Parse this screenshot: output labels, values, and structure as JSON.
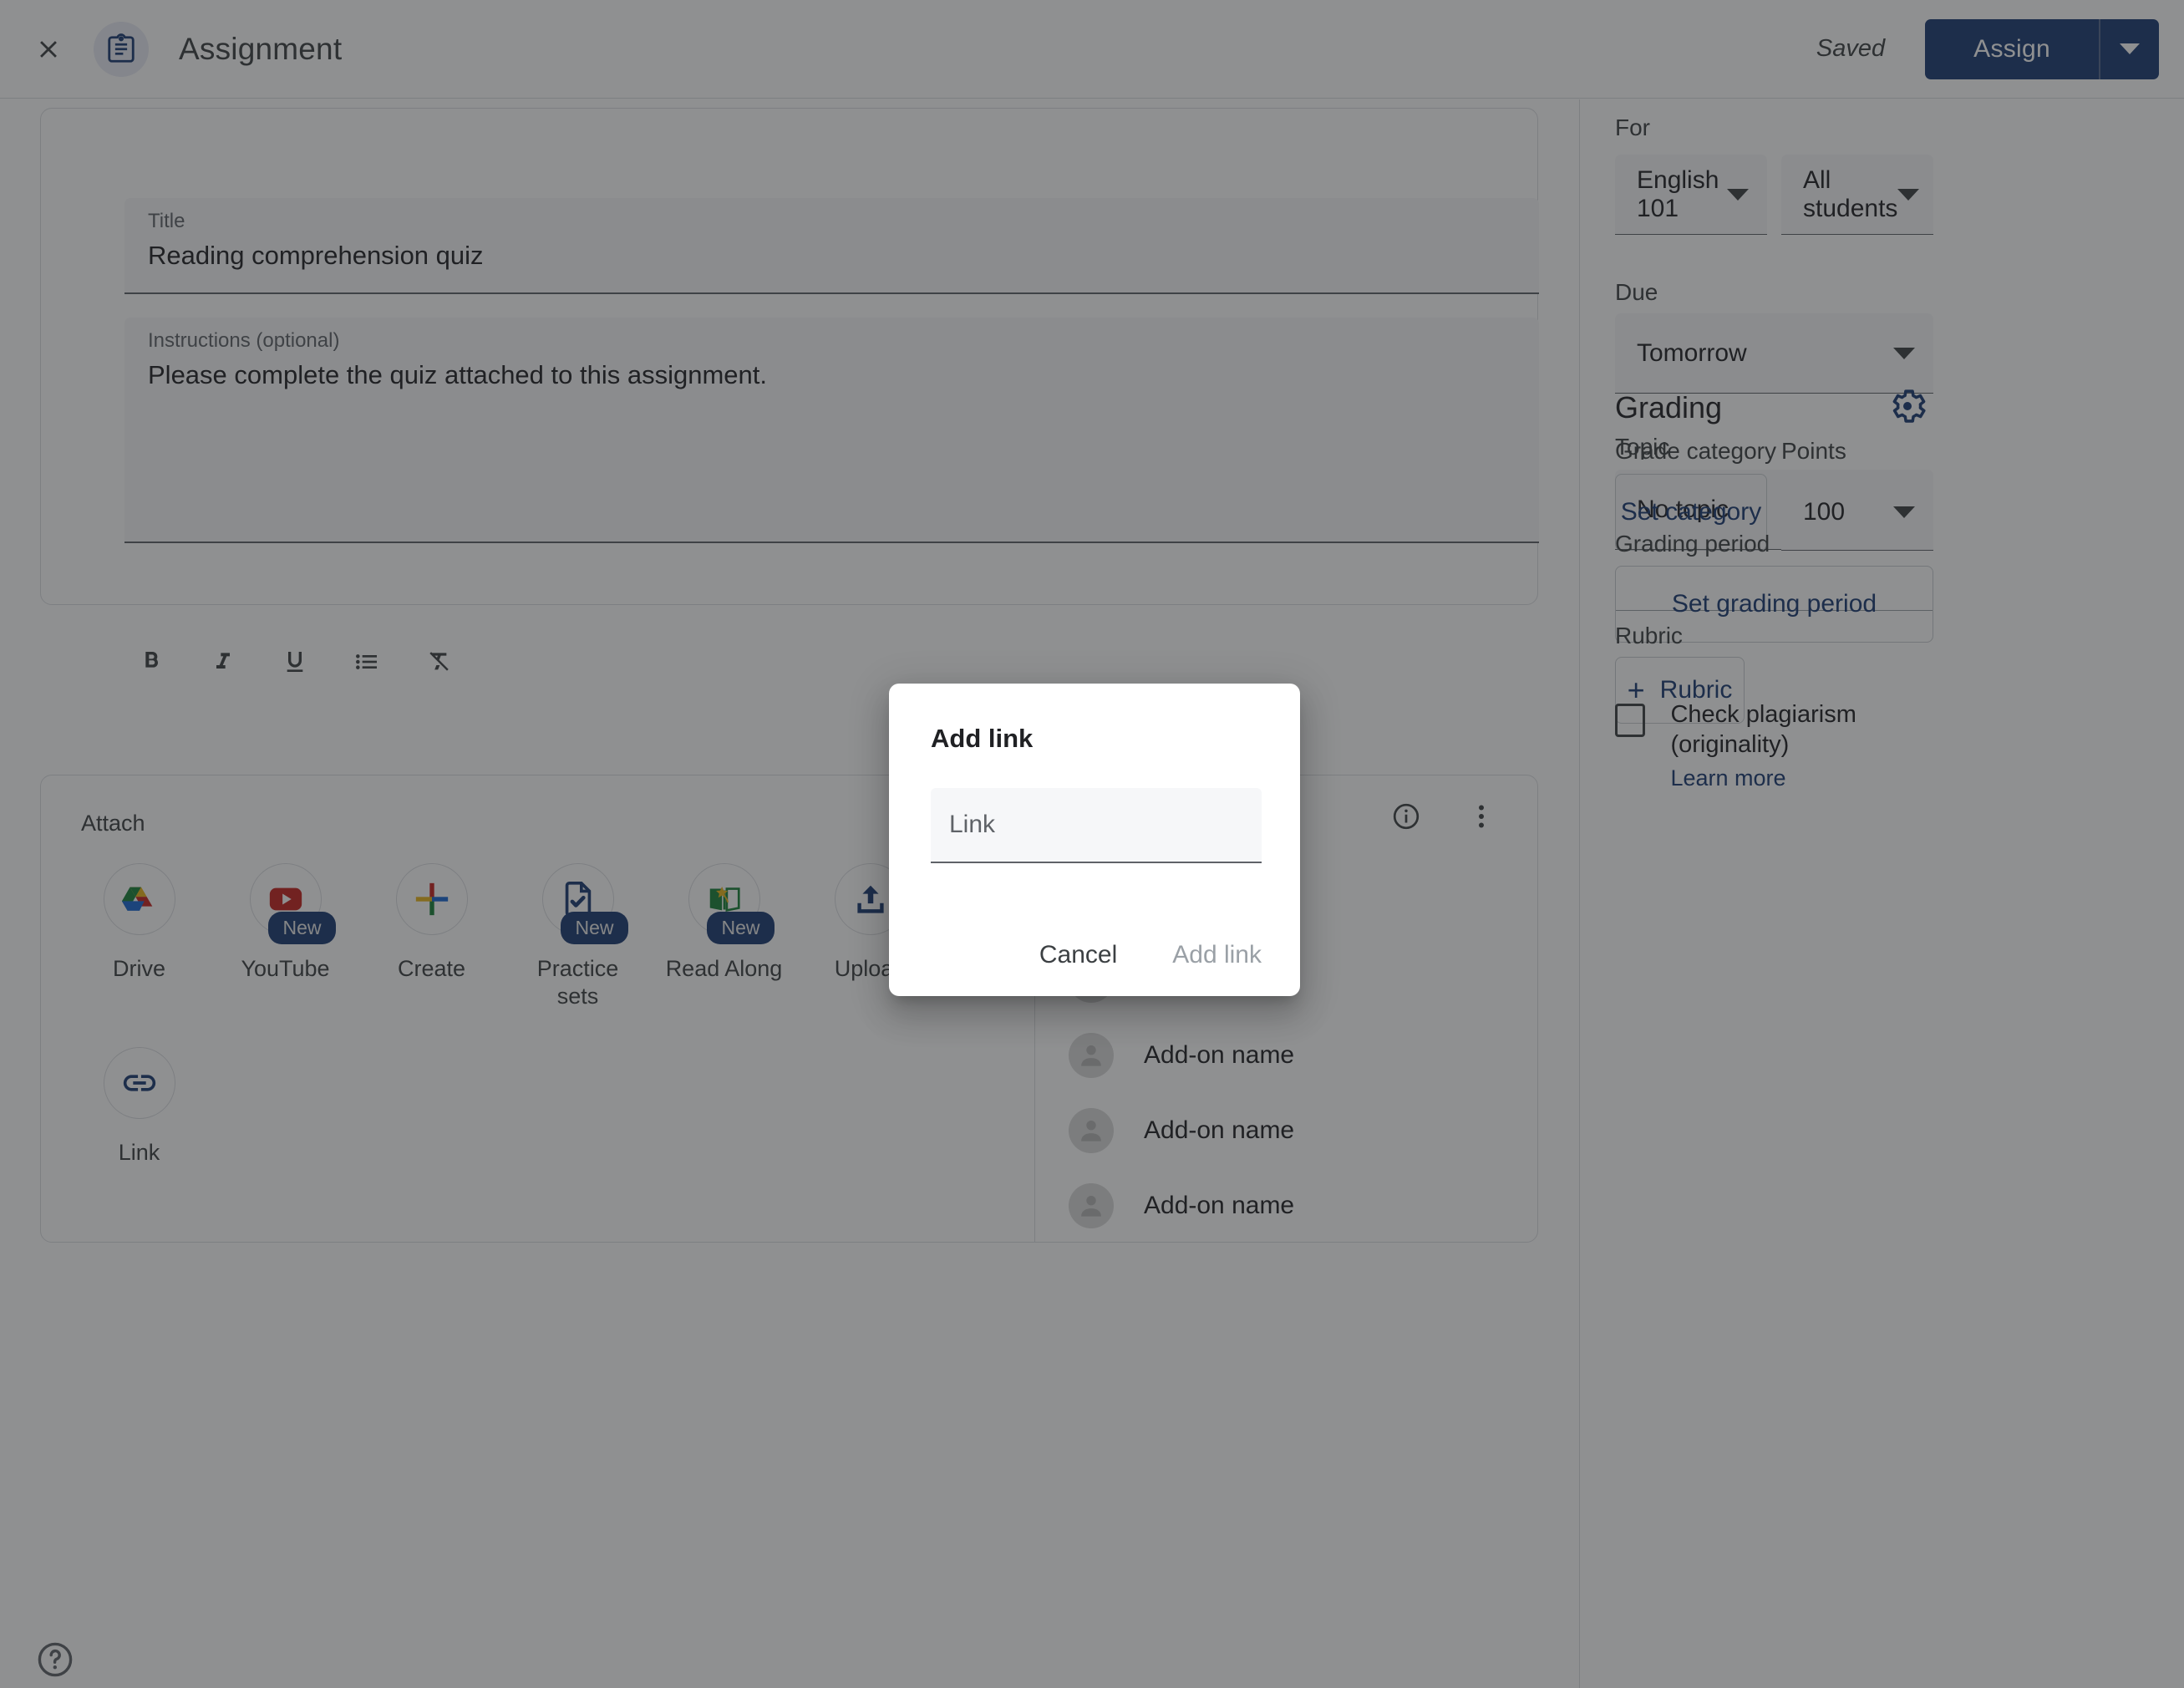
{
  "header": {
    "close_icon": "close-icon",
    "doc_icon": "assignment-clipboard-icon",
    "title": "Assignment",
    "saved_label": "Saved",
    "assign_label": "Assign",
    "assign_caret_icon": "chevron-down-icon",
    "accent_color": "#1a3a73"
  },
  "details": {
    "title_label": "Title",
    "title_value": "Reading comprehension quiz",
    "instructions_label": "Instructions (optional)",
    "instructions_value": "Please complete the quiz attached to this assignment.",
    "toolbar": [
      {
        "name": "bold-icon",
        "label": "B"
      },
      {
        "name": "italic-icon",
        "label": "I"
      },
      {
        "name": "underline-icon",
        "label": "U"
      },
      {
        "name": "bulleted-list-icon",
        "label": "List"
      },
      {
        "name": "clear-formatting-icon",
        "label": "Clear formatting"
      }
    ]
  },
  "attach": {
    "heading": "Attach",
    "tiles": [
      {
        "name": "drive-icon",
        "label": "Drive",
        "badge": ""
      },
      {
        "name": "youtube-icon",
        "label": "YouTube",
        "badge": "New"
      },
      {
        "name": "create-icon",
        "label": "Create",
        "badge": ""
      },
      {
        "name": "practice-sets-icon",
        "label": "Practice sets",
        "badge": "New"
      },
      {
        "name": "read-along-icon",
        "label": "Read Along",
        "badge": "New"
      },
      {
        "name": "upload-icon",
        "label": "Upload",
        "badge": ""
      }
    ],
    "tiles_row2": [
      {
        "name": "link-icon",
        "label": "Link",
        "badge": ""
      }
    ],
    "addons": {
      "info_icon": "info-icon",
      "overflow_icon": "more-vert-icon",
      "items": [
        {
          "avatar": "person-avatar-icon",
          "label": "Add-on name"
        },
        {
          "avatar": "person-avatar-icon",
          "label": "Add-on name"
        },
        {
          "avatar": "person-avatar-icon",
          "label": "Add-on name"
        },
        {
          "avatar": "person-avatar-icon",
          "label": "Add-on name"
        }
      ]
    }
  },
  "help": {
    "icon": "help-circle-icon"
  },
  "sidebar": {
    "for_label": "For",
    "course_value": "English 101",
    "students_value": "All students",
    "due_label": "Due",
    "due_value": "Tomorrow",
    "topic_label": "Topic",
    "topic_value": "No topic",
    "grading_title": "Grading",
    "grading_settings_icon": "gear-icon",
    "grade_category_label": "Grade category",
    "set_category_label": "Set category",
    "points_label": "Points",
    "points_value": "100",
    "grading_period_label": "Grading period",
    "set_grading_period_label": "Set grading period",
    "rubric_label": "Rubric",
    "rubric_button_label": "Rubric",
    "plagiarism_label": "Check plagiarism (originality)",
    "learn_more_label": "Learn more"
  },
  "dialog": {
    "title": "Add link",
    "input_placeholder": "Link",
    "input_value": "",
    "cancel_label": "Cancel",
    "submit_label": "Add link"
  }
}
